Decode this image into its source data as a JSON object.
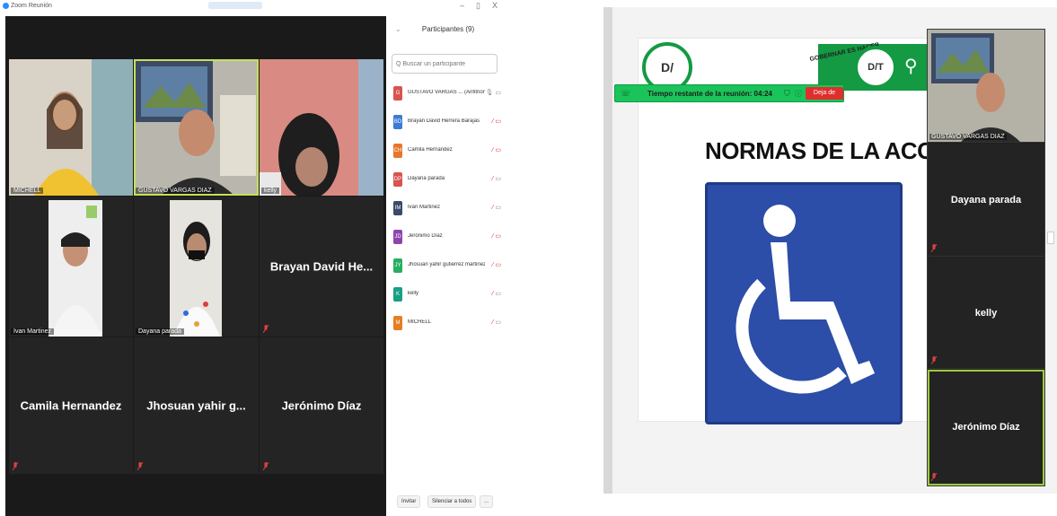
{
  "zoom": {
    "window_title": "Zoom Reunión",
    "minimize": "–",
    "restore": "▯",
    "close": "X",
    "tiles": [
      {
        "name": "MICHELL",
        "type": "video"
      },
      {
        "name": "GUSTAVO VARGAS DIAZ",
        "type": "video",
        "active": true
      },
      {
        "name": "kelly",
        "type": "video"
      },
      {
        "name": "Ivan Martinez",
        "type": "video"
      },
      {
        "name": "Dayana parada",
        "type": "video"
      },
      {
        "name": "Brayan David He...",
        "type": "name"
      },
      {
        "name": "Camila Hernandez",
        "type": "name"
      },
      {
        "name": "Jhosuan yahir g...",
        "type": "name"
      },
      {
        "name": "Jerónimo Díaz",
        "type": "name"
      }
    ]
  },
  "participants_panel": {
    "title": "Participantes (9)",
    "search_placeholder": "Q Buscar un participante",
    "items": [
      {
        "initials": "G",
        "name": "GUSTAVO VARGAS ... (Anfitrión, yo)",
        "color": "#d9534f",
        "muted": false
      },
      {
        "initials": "BD",
        "name": "Brayan David Herrera Barajas",
        "color": "#3a7bd5",
        "muted": true
      },
      {
        "initials": "CH",
        "name": "Camila Hernandez",
        "color": "#e6762e",
        "muted": true
      },
      {
        "initials": "DP",
        "name": "Dayana parada",
        "color": "#d9534f",
        "muted": true
      },
      {
        "initials": "IM",
        "name": "Ivan Martinez",
        "color": "#3b4a6b",
        "muted": true
      },
      {
        "initials": "JD",
        "name": "Jerónimo Díaz",
        "color": "#8e44ad",
        "muted": true
      },
      {
        "initials": "JY",
        "name": "Jhosuan yahir gutierrez martinez",
        "color": "#27ae60",
        "muted": true
      },
      {
        "initials": "K",
        "name": "kelly",
        "color": "#16a085",
        "muted": true
      },
      {
        "initials": "M",
        "name": "MICHELL",
        "color": "#e67e22",
        "muted": true
      }
    ],
    "invite_label": "Invitar",
    "mute_all_label": "Silenciar a todos",
    "more_label": "..."
  },
  "shared_screen": {
    "slide_title": "NORMAS DE LA ACCESIBIL",
    "seal_left": "D/",
    "seal_right": "D/T",
    "gobernar": "GOBERNAR ES HACER",
    "timer_text": "Tiempo restante de la reunión: 04:24",
    "leave_label": "Deja de",
    "strip": [
      {
        "name": "GUSTAVO VARGAS DIAZ",
        "type": "video"
      },
      {
        "name": "Dayana parada",
        "type": "name"
      },
      {
        "name": "kelly",
        "type": "name"
      },
      {
        "name": "Jerónimo Díaz",
        "type": "name"
      }
    ]
  },
  "colors": {
    "zoom_accent": "#2d8cff",
    "active_speaker": "#c6e05a",
    "timer_green": "#1ac45a",
    "leave_red": "#e02e2e",
    "sign_blue": "#2c4da8"
  }
}
